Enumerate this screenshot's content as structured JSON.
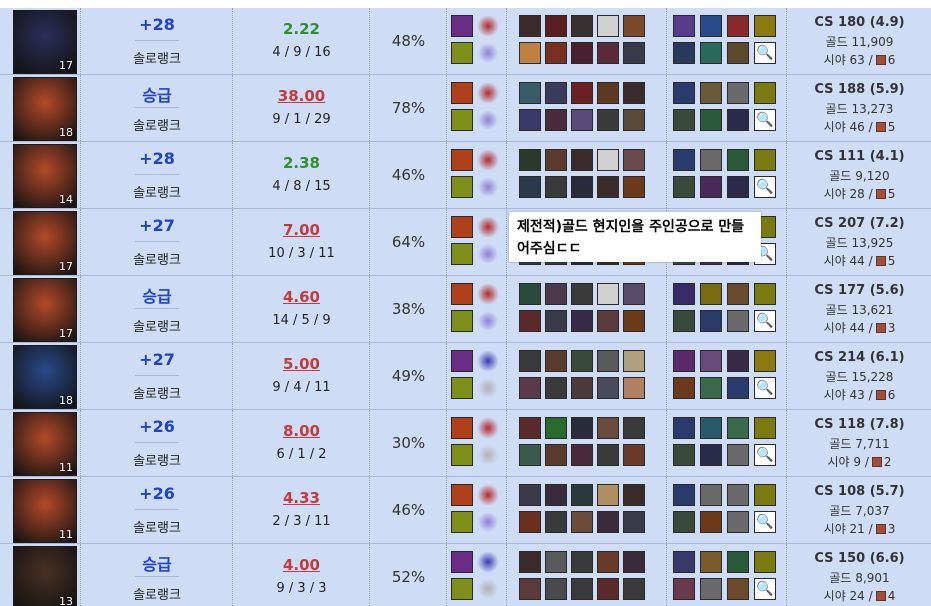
{
  "tooltip": {
    "text": "제전적)골드 현지인을 주인공으로 만들어주심ㄷㄷ"
  },
  "rows": [
    {
      "level": "17",
      "portrait_color": "#2b2f5a",
      "lp": "+28",
      "queue": "솔로랭크",
      "kda_ratio": "2.22",
      "kda_color": "green",
      "kda": "4 / 9 / 16",
      "cp": "48%",
      "spell1": "#6b2c86",
      "spell2": "#b12a2a",
      "spell3": "#7e8f1a",
      "rune": "#8c7fd6",
      "champs": [
        "#3a2a2a",
        "#5a2020",
        "#3a3030",
        "#d0d0d0",
        "#7a4a2a",
        "#c08040",
        "#7a3020",
        "#4a2030",
        "#5a2a3a",
        "#3a3a4a"
      ],
      "items": [
        "#5a3a8a",
        "#2a4a8a",
        "#8a2a2a",
        "#8a7a10",
        "#2a3a5a",
        "#2a6a5a",
        "#5a4a2a"
      ],
      "cs": "CS 180 (4.9)",
      "gold": "골드 11,909",
      "vision": "시야 63 /",
      "wards": "6"
    },
    {
      "level": "18",
      "portrait_color": "#b44a2a",
      "lp": "승급",
      "queue": "솔로랭크",
      "kda_ratio": "38.00",
      "kda_color": "red",
      "kda": "9 / 1 / 29",
      "cp": "78%",
      "spell1": "#b0401a",
      "spell2": "#b12a2a",
      "spell3": "#7e8f1a",
      "rune": "#8c7fd6",
      "champs": [
        "#3a5a6a",
        "#3a3a5a",
        "#6a2020",
        "#5a3a20",
        "#3a2a2a",
        "#3a3a6a",
        "#4a2a3a",
        "#5a4a7a",
        "#3a3a3a",
        "#5a4a3a"
      ],
      "items": [
        "#2a3a6a",
        "#6a5a3a",
        "#6a6a6a",
        "#7a7a10",
        "#3a4a3a",
        "#2a5a3a",
        "#2a2a4a"
      ],
      "cs": "CS 188 (5.9)",
      "gold": "골드 13,273",
      "vision": "시야 46 /",
      "wards": "5"
    },
    {
      "level": "14",
      "portrait_color": "#b44a2a",
      "lp": "+28",
      "queue": "솔로랭크",
      "kda_ratio": "2.38",
      "kda_color": "green",
      "kda": "4 / 8 / 15",
      "cp": "46%",
      "spell1": "#b0401a",
      "spell2": "#b12a2a",
      "spell3": "#7e8f1a",
      "rune": "#8c7fd6",
      "champs": [
        "#2a3a2a",
        "#5a3a2a",
        "#3a2a2a",
        "#d0d0d0",
        "#6a4a4a",
        "#2a3a4a",
        "#3a3a3a",
        "#2a2a3a",
        "#3a2a2a",
        "#6a3a1a"
      ],
      "items": [
        "#2a3a6a",
        "#6a6a6a",
        "#2a5a3a",
        "#7a7a10",
        "#3a4a3a",
        "#4a2a5a",
        "#2a2a4a"
      ],
      "cs": "CS 111 (4.1)",
      "gold": "골드 9,120",
      "vision": "시야 28 /",
      "wards": "5"
    },
    {
      "level": "17",
      "portrait_color": "#b44a2a",
      "lp": "+27",
      "queue": "솔로랭크",
      "kda_ratio": "7.00",
      "kda_color": "red",
      "kda": "10 / 3 / 11",
      "cp": "64%",
      "spell1": "#b0401a",
      "spell2": "#b12a2a",
      "spell3": "#7e8f1a",
      "rune": "#8c7fd6",
      "champs": [
        "#3a3a3a",
        "#5a3a2a",
        "#3a2a3a",
        "#d0d0d0",
        "#6a4a4a",
        "#2a3a4a",
        "#3a3a3a",
        "#2a2a3a",
        "#3a2a2a",
        "#6a3a1a"
      ],
      "items": [
        "#2a3a6a",
        "#6a6a6a",
        "#2a5a3a",
        "#7a7a10",
        "#3a4a3a",
        "#4a2a5a",
        "#2a2a4a"
      ],
      "cs": "CS 207 (7.2)",
      "gold": "골드 13,925",
      "vision": "시야 44 /",
      "wards": "5"
    },
    {
      "level": "17",
      "portrait_color": "#b44a2a",
      "lp": "승급",
      "queue": "솔로랭크",
      "kda_ratio": "4.60",
      "kda_color": "red",
      "kda": "14 / 5 / 9",
      "cp": "38%",
      "spell1": "#b0401a",
      "spell2": "#b12a2a",
      "spell3": "#7e8f1a",
      "rune": "#8c7fd6",
      "champs": [
        "#2a4a3a",
        "#4a3a4a",
        "#3a3a3a",
        "#d0d0d0",
        "#5a4a6a",
        "#5a2a2a",
        "#3a3a4a",
        "#3a2a4a",
        "#5a3a3a",
        "#6a3a1a"
      ],
      "items": [
        "#3a2a6a",
        "#7a6a10",
        "#6a4a2a",
        "#7a7a10",
        "#3a4a3a",
        "#2a3a6a",
        "#6a6a6a"
      ],
      "cs": "CS 177 (5.6)",
      "gold": "골드 13,621",
      "vision": "시야 44 /",
      "wards": "3"
    },
    {
      "level": "18",
      "portrait_color": "#2a4a8a",
      "lp": "+27",
      "queue": "솔로랭크",
      "kda_ratio": "5.00",
      "kda_color": "red",
      "kda": "9 / 4 / 11",
      "cp": "49%",
      "spell1": "#6b2c86",
      "spell2": "#3a3ab0",
      "spell3": "#7e8f1a",
      "rune": "#b0b0b0",
      "champs": [
        "#3a3a3a",
        "#5a3a2a",
        "#3a4a3a",
        "#5a5a5a",
        "#b0a080",
        "#5a3a4a",
        "#3a3a3a",
        "#4a3a3a",
        "#4a4a5a",
        "#b08060"
      ],
      "items": [
        "#5a2a6a",
        "#6a4a7a",
        "#3a2a4a",
        "#8a7a10",
        "#6a3a1a",
        "#3a6a4a",
        "#2a3a6a"
      ],
      "cs": "CS 214 (6.1)",
      "gold": "골드 15,228",
      "vision": "시야 43 /",
      "wards": "6"
    },
    {
      "level": "11",
      "portrait_color": "#b44a2a",
      "lp": "+26",
      "queue": "솔로랭크",
      "kda_ratio": "8.00",
      "kda_color": "red",
      "kda": "6 / 1 / 2",
      "cp": "30%",
      "spell1": "#b0401a",
      "spell2": "#b12a2a",
      "spell3": "#7e8f1a",
      "rune": "#b0b0b0",
      "champs": [
        "#5a2a2a",
        "#2a6a2a",
        "#2a2a3a",
        "#6a4a3a",
        "#3a3a3a",
        "#3a5a4a",
        "#5a3a2a",
        "#4a2a3a",
        "#3a3a3a",
        "#6a3a2a"
      ],
      "items": [
        "#2a3a6a",
        "#2a5a6a",
        "#3a6a4a",
        "#7a7a10",
        "#3a4a3a",
        "#2a2a4a",
        "#6a6a6a"
      ],
      "cs": "CS 118 (7.8)",
      "gold": "골드 7,711",
      "vision": "시야 9 /",
      "wards": "2"
    },
    {
      "level": "11",
      "portrait_color": "#b44a2a",
      "lp": "+26",
      "queue": "솔로랭크",
      "kda_ratio": "4.33",
      "kda_color": "red",
      "kda": "2 / 3 / 11",
      "cp": "46%",
      "spell1": "#b0401a",
      "spell2": "#b12a2a",
      "spell3": "#7e8f1a",
      "rune": "#8c7fd6",
      "champs": [
        "#3a3a4a",
        "#3a2a3a",
        "#2a3a3a",
        "#b09060",
        "#3a2a2a",
        "#6a3020",
        "#3a3a3a",
        "#6a4a3a",
        "#3a2a3a",
        "#3a3a4a"
      ],
      "items": [
        "#2a3a6a",
        "#6a6a6a",
        "#6a6a6a",
        "#7a7a10",
        "#3a4a3a",
        "#6a3a1a",
        "#6a6a6a"
      ],
      "cs": "CS 108 (5.7)",
      "gold": "골드 7,037",
      "vision": "시야 21 /",
      "wards": "3"
    },
    {
      "level": "13",
      "portrait_color": "#4a3024",
      "lp": "승급",
      "queue": "솔로랭크",
      "kda_ratio": "4.00",
      "kda_color": "red",
      "kda": "9 / 3 / 3",
      "cp": "52%",
      "spell1": "#6b2c86",
      "spell2": "#3a3ab0",
      "spell3": "#7e8f1a",
      "rune": "#b0b0b0",
      "champs": [
        "#3a2a2a",
        "#5a5a5a",
        "#3a3a3a",
        "#6a3a2a",
        "#3a2a3a",
        "#5a3a3a",
        "#4a4a4a",
        "#3a3a3a",
        "#5a2a2a",
        "#3a3a3a"
      ],
      "items": [
        "#3a3a6a",
        "#7a5a2a",
        "#2a5a3a",
        "#7a7a10",
        "#6a3a4a",
        "#6a6a6a",
        "#6a4a2a"
      ],
      "cs": "CS 150 (6.6)",
      "gold": "골드 8,901",
      "vision": "시야 24 /",
      "wards": "4"
    }
  ]
}
